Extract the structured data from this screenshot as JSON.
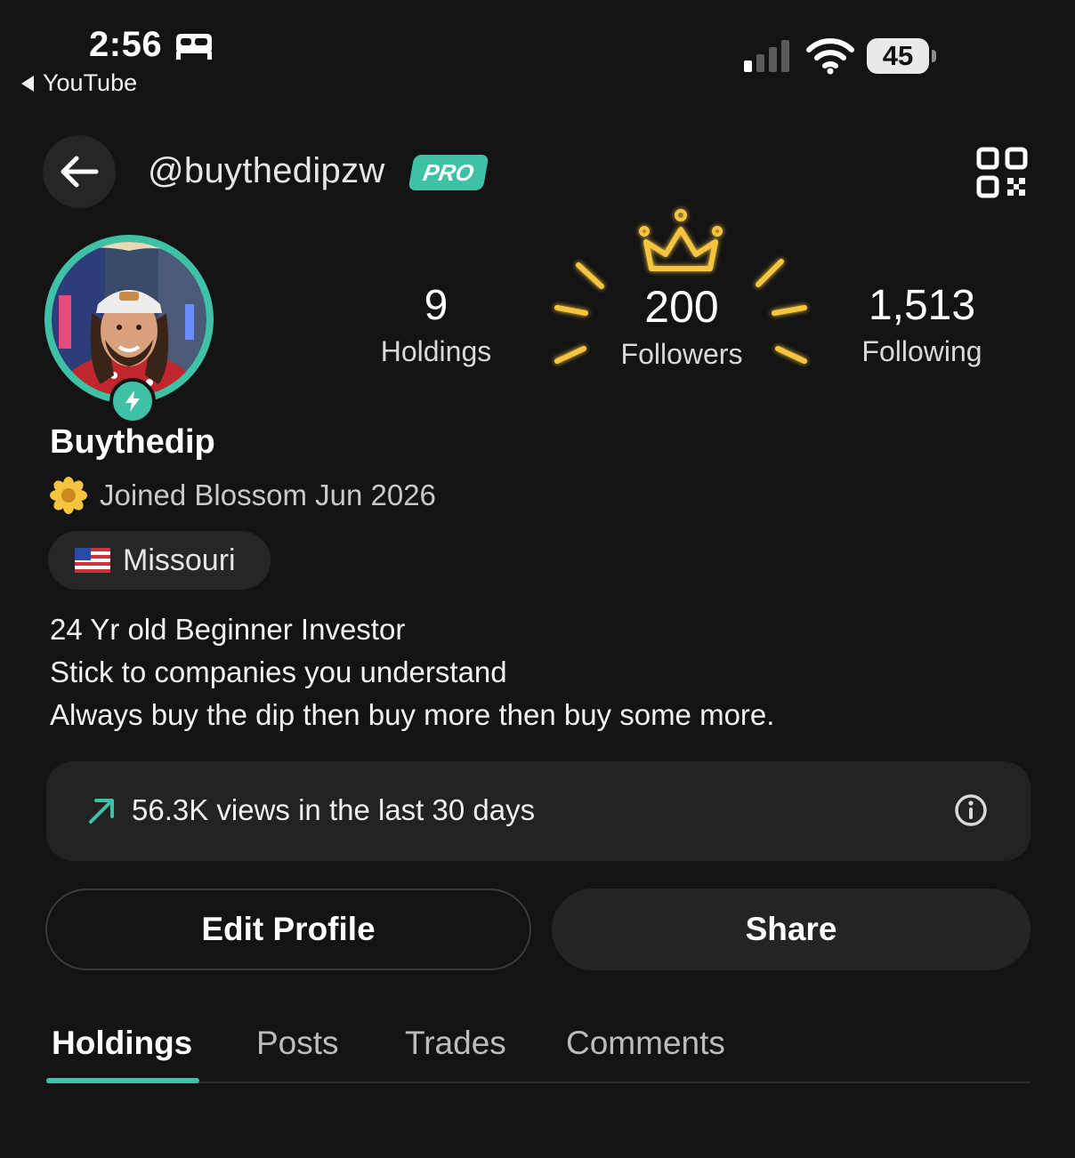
{
  "status_bar": {
    "time": "2:56",
    "back_app": "YouTube",
    "battery": "45"
  },
  "header": {
    "handle": "@buythedipzw",
    "badge": "PRO"
  },
  "stats": {
    "holdings": {
      "value": "9",
      "label": "Holdings"
    },
    "followers": {
      "value": "200",
      "label": "Followers"
    },
    "following": {
      "value": "1,513",
      "label": "Following"
    }
  },
  "profile": {
    "name": "Buythedip",
    "joined": "Joined Blossom Jun 2026",
    "location": "Missouri",
    "bio": [
      "24 Yr old Beginner Investor",
      "Stick to companies you understand",
      "Always buy the dip then buy more then buy some more."
    ]
  },
  "views": {
    "text": "56.3K views in the last 30 days"
  },
  "buttons": {
    "edit": "Edit Profile",
    "share": "Share"
  },
  "tabs": [
    "Holdings",
    "Posts",
    "Trades",
    "Comments"
  ],
  "colors": {
    "accent": "#3fc1a6",
    "background": "#131313",
    "card": "#222222",
    "gold": "#f5c542"
  }
}
